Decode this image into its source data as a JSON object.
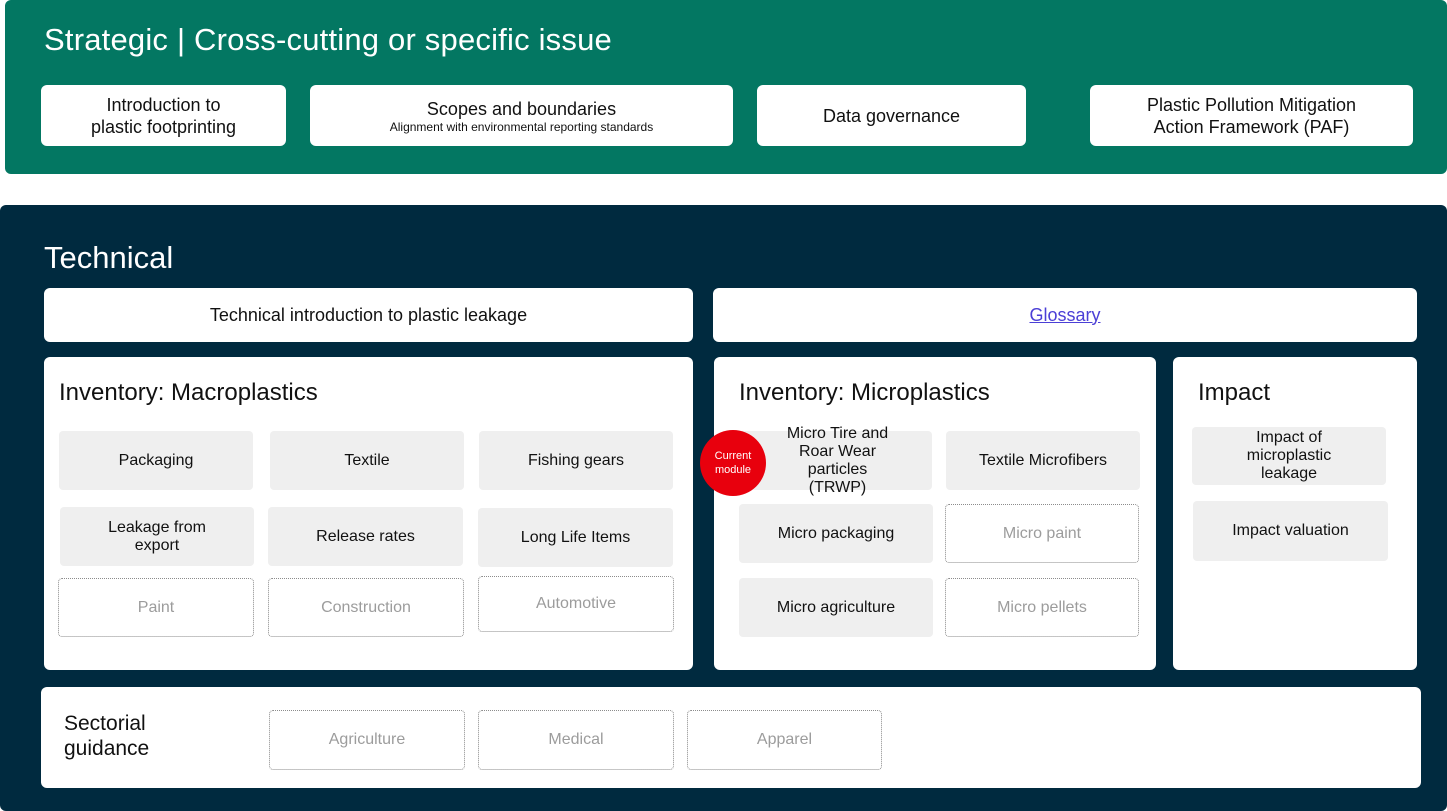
{
  "strategic": {
    "title": "Strategic | Cross-cutting or specific issue",
    "boxes": [
      {
        "line1": "Introduction to",
        "line2": "plastic footprinting"
      },
      {
        "main": "Scopes and boundaries",
        "sub": "Alignment with environmental reporting standards"
      },
      {
        "main": "Data governance"
      },
      {
        "line1": "Plastic Pollution Mitigation",
        "line2": "Action Framework  (PAF)"
      }
    ]
  },
  "technical": {
    "title": "Technical",
    "intro": "Technical introduction to plastic leakage",
    "glossary": "Glossary",
    "macro": {
      "title": "Inventory: Macroplastics",
      "tiles": [
        "Packaging",
        "Textile",
        "Fishing gears",
        "Leakage from export",
        "Release rates",
        "Long Life Items"
      ],
      "future": [
        "Paint",
        "Construction",
        "Automotive"
      ]
    },
    "micro": {
      "title": "Inventory: Microplastics",
      "tiles": [
        "Micro Tire and Roar Wear particles (TRWP)",
        "Textile Microfibers",
        "Micro packaging",
        "Micro agriculture"
      ],
      "future": [
        "Micro paint",
        "Micro pellets"
      ],
      "badge": {
        "line1": "Current",
        "line2": "module"
      }
    },
    "impact": {
      "title": "Impact",
      "tiles": [
        "Impact of microplastic leakage",
        "Impact valuation"
      ]
    },
    "sectorial": {
      "title_line1": "Sectorial",
      "title_line2": "guidance",
      "future": [
        "Agriculture",
        "Medical",
        "Apparel"
      ]
    }
  },
  "colors": {
    "strategic_bg": "#037762",
    "technical_bg": "#002a3f",
    "badge": "#e8000d",
    "link": "#4b3fd6"
  }
}
